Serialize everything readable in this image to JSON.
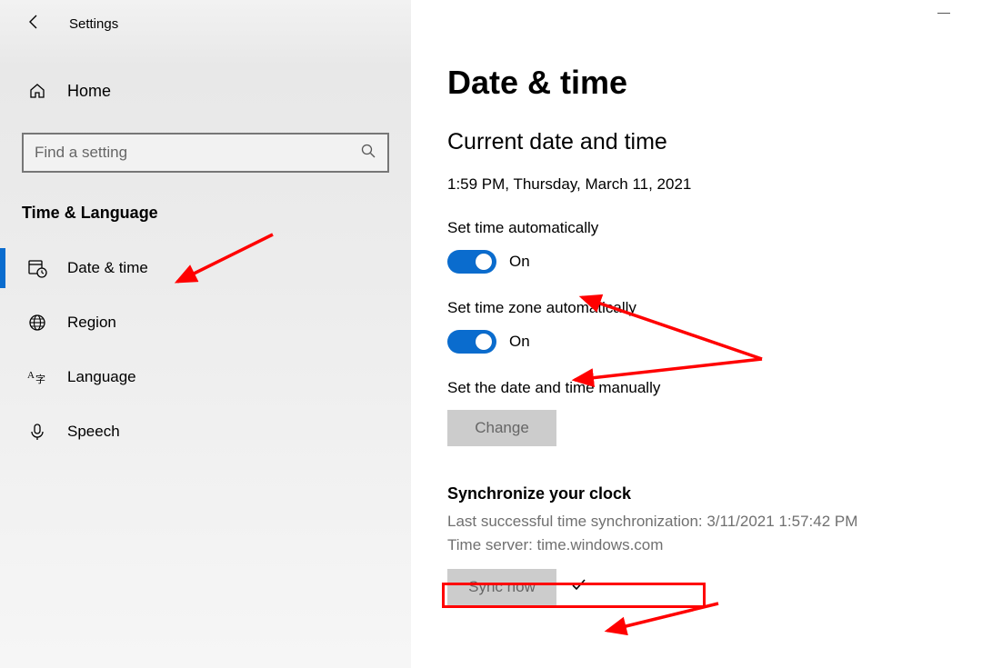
{
  "window": {
    "title": "Settings"
  },
  "sidebar": {
    "home_label": "Home",
    "search_placeholder": "Find a setting",
    "category": "Time & Language",
    "items": [
      {
        "label": "Date & time"
      },
      {
        "label": "Region"
      },
      {
        "label": "Language"
      },
      {
        "label": "Speech"
      }
    ]
  },
  "main": {
    "heading": "Date & time",
    "current_section": "Current date and time",
    "current_value": "1:59 PM, Thursday, March 11, 2021",
    "set_time_auto_label": "Set time automatically",
    "set_time_auto_state": "On",
    "set_tz_auto_label": "Set time zone automatically",
    "set_tz_auto_state": "On",
    "manual_label": "Set the date and time manually",
    "change_button": "Change",
    "sync_heading": "Synchronize your clock",
    "last_sync": "Last successful time synchronization: 3/11/2021 1:57:42 PM",
    "time_server": "Time server: time.windows.com",
    "sync_button": "Sync now"
  }
}
